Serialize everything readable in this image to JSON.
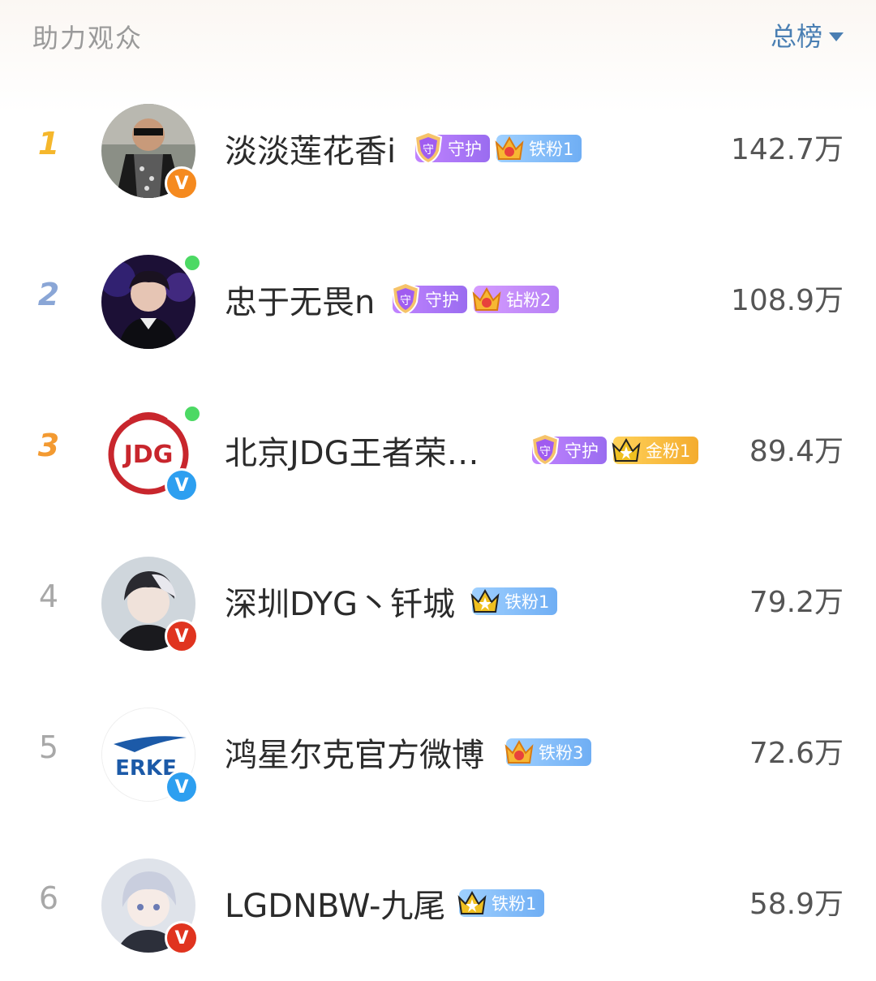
{
  "header": {
    "title": "助力观众",
    "sort_label": "总榜"
  },
  "rows": [
    {
      "rank": "1",
      "name": "淡淡莲花香i",
      "score": "142.7万",
      "badges": [
        {
          "type": "guard",
          "label": "守护"
        },
        {
          "type": "iron",
          "label": "铁粉1"
        }
      ]
    },
    {
      "rank": "2",
      "name": "忠于无畏n",
      "score": "108.9万",
      "badges": [
        {
          "type": "guard",
          "label": "守护"
        },
        {
          "type": "diamond",
          "label": "钻粉2"
        }
      ]
    },
    {
      "rank": "3",
      "name": "北京JDG王者荣…",
      "score": "89.4万",
      "badges": [
        {
          "type": "guard",
          "label": "守护"
        },
        {
          "type": "gold",
          "label": "金粉1"
        }
      ]
    },
    {
      "rank": "4",
      "name": "深圳DYG丶钎城",
      "score": "79.2万",
      "badges": [
        {
          "type": "iron",
          "label": "铁粉1"
        }
      ]
    },
    {
      "rank": "5",
      "name": "鸿星尔克官方微博",
      "score": "72.6万",
      "badges": [
        {
          "type": "iron",
          "label": "铁粉3"
        }
      ]
    },
    {
      "rank": "6",
      "name": "LGDNBW-九尾",
      "score": "58.9万",
      "badges": [
        {
          "type": "iron",
          "label": "铁粉1"
        }
      ]
    }
  ],
  "colors": {
    "sort_accent": "#4a7fb3",
    "rank1": "#f5b72c",
    "rank2": "#8aa6d6",
    "rank3": "#f39a31"
  },
  "icons": {
    "guard": "shield-icon",
    "crown": "crown-icon",
    "verified": "v-icon",
    "online": "online-dot"
  }
}
